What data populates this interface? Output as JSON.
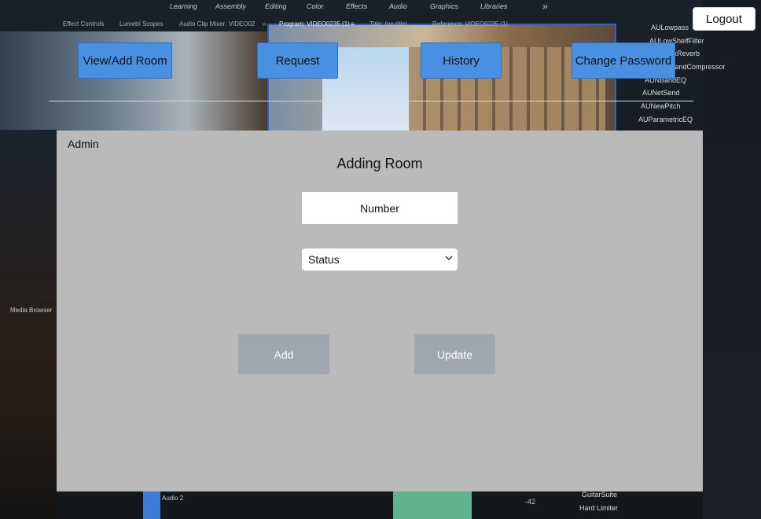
{
  "background": {
    "top_menu": [
      "Learning",
      "Assembly",
      "Editing",
      "Color",
      "Effects",
      "Audio",
      "Graphics",
      "Libraries",
      "»"
    ],
    "panel_tabs": [
      "Effect Controls",
      "Lumetri Scopes",
      "Audio Clip Mixer: VIDEO02",
      "»",
      "Program: VIDEO0235 (1)",
      "≡",
      "Title: (no title)",
      "Reference: VIDEO0235 (1)"
    ],
    "effects_list": [
      "AULowpass",
      "AULowShelfFilter",
      "AUMatrixReverb",
      "AUMultibandCompressor",
      "AUNBandEQ",
      "AUNetSend",
      "AUNewPitch",
      "AUParametricEQ"
    ],
    "media_browser": "Media Browser",
    "audio_track": "Audio 2",
    "bottom_effects": [
      "GuitarSuite",
      "Hard Limiter"
    ],
    "meter_value": "-42"
  },
  "nav": {
    "view_add_room": "View/Add Room",
    "request": "Request",
    "history": "History",
    "change_password": "Change Password"
  },
  "logout_label": "Logout",
  "panel": {
    "role_label": "Admin",
    "title": "Adding Room",
    "number_placeholder": "Number",
    "status_selected": "Status",
    "add_label": "Add",
    "update_label": "Update"
  },
  "colors": {
    "nav_button": "#4a90e2",
    "panel_bg": "#bababa",
    "action_button": "#a0a6ad"
  }
}
